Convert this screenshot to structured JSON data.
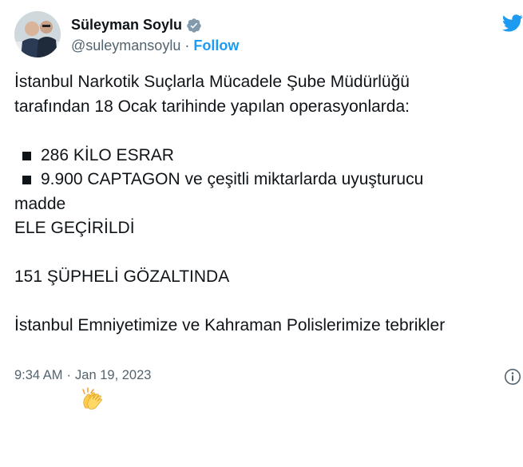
{
  "tweet": {
    "author_name": "Süleyman Soylu",
    "author_handle": "@suleymansoylu",
    "separator": "·",
    "follow_label": "Follow",
    "lines": [
      "İstanbul Narkotik Suçlarla Mücadele Şube Müdürlüğü",
      "tarafından 18 Ocak tarihinde yapılan operasyonlarda:"
    ],
    "bullets": [
      "286 KİLO ESRAR",
      "9.900 CAPTAGON ve çeşitli miktarlarda uyuşturucu"
    ],
    "continuation": "madde",
    "seized": "ELE GEÇİRİLDİ",
    "detained": "151 ŞÜPHELİ GÖZALTINDA",
    "congrats": "İstanbul Emniyetimize ve Kahraman Polislerimize tebrikler",
    "time": "9:34 AM",
    "date": "Jan 19, 2023"
  },
  "icons": {
    "verified": "verified-badge-icon",
    "brand": "twitter-bird-icon",
    "emoji": "clapping-hands-icon",
    "info": "info-icon"
  },
  "colors": {
    "accent": "#1d9bf0",
    "text": "#0f1419",
    "muted": "#536471"
  }
}
